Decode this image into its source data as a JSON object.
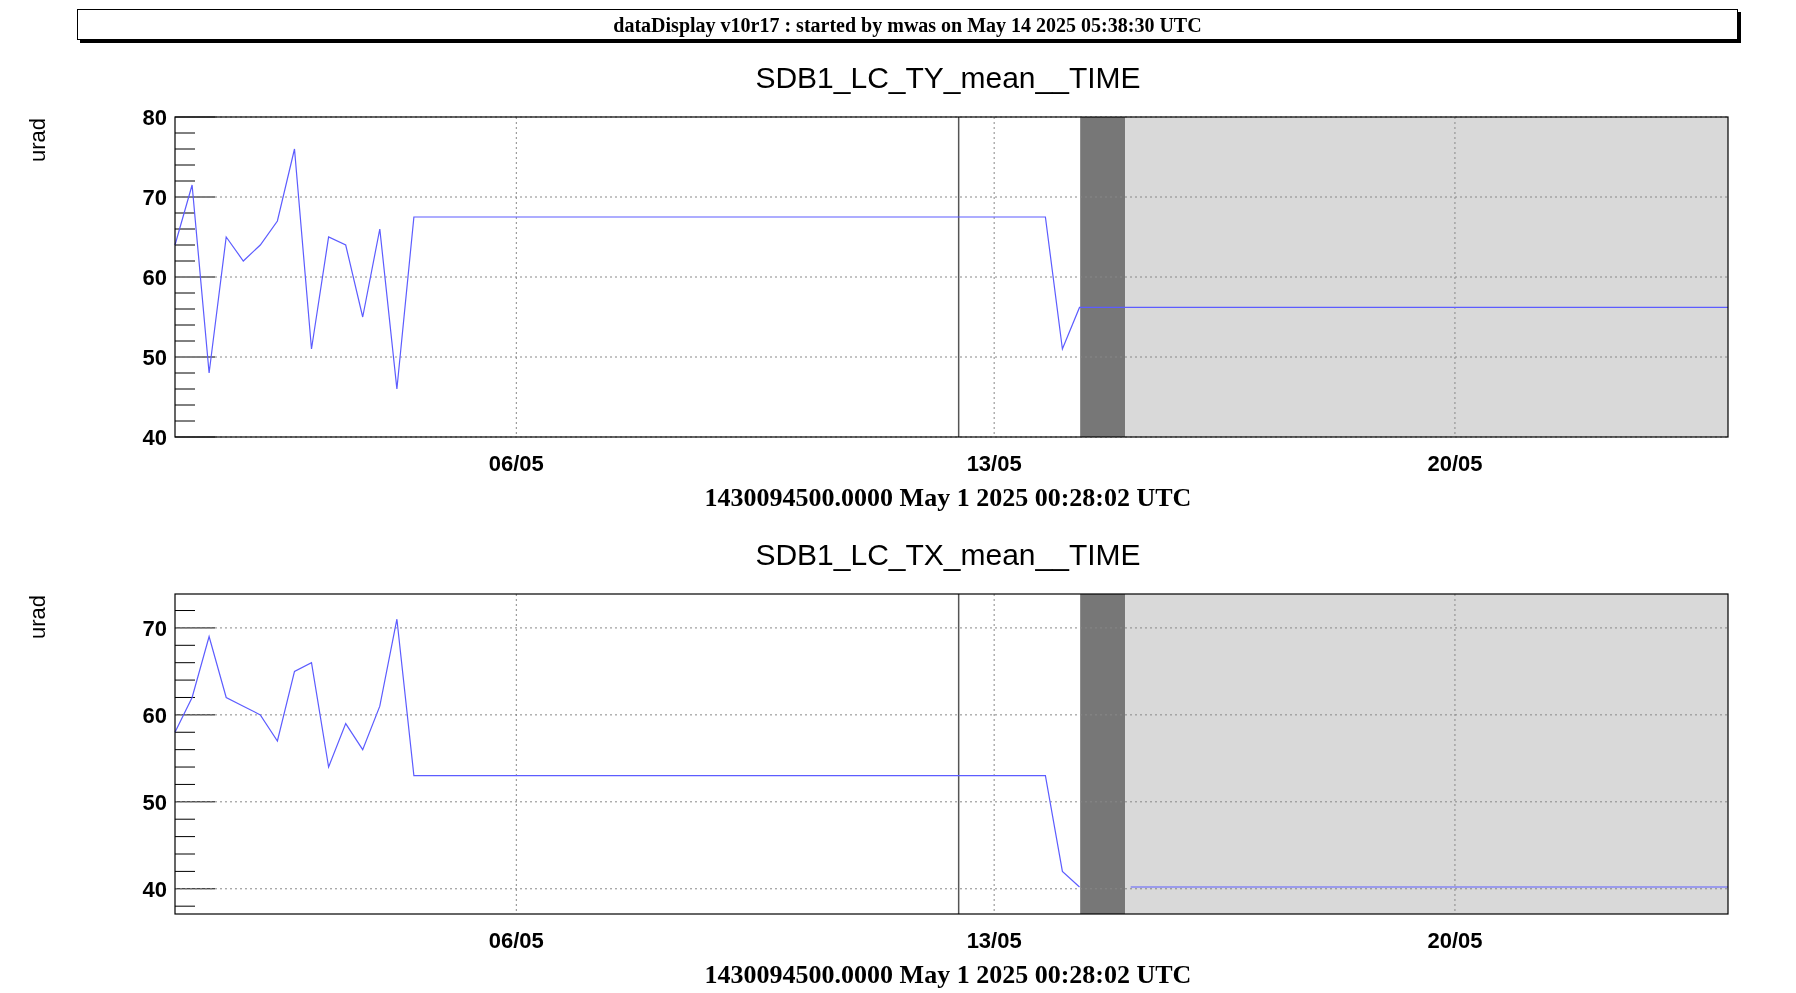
{
  "header": {
    "title": "dataDisplay v10r17 : started by mwas on May 14 2025 05:38:30 UTC"
  },
  "panels": [
    {
      "chart_data": {
        "type": "line",
        "title": "SDB1_LC_TY_mean__TIME",
        "xlabel": "1430094500.0000 May 1 2025 00:28:02 UTC",
        "ylabel": "urad",
        "categories": [
          null,
          null,
          null,
          null,
          null,
          null,
          null,
          null,
          null,
          null,
          null,
          null,
          null,
          null,
          null,
          null,
          null,
          null,
          null,
          null,
          "06/05",
          null,
          null,
          null,
          null,
          null,
          null,
          null,
          null,
          null,
          null,
          null,
          null,
          null,
          null,
          null,
          null,
          null,
          null,
          null,
          null,
          null,
          null,
          null,
          null,
          null,
          null,
          null,
          "13/05",
          null,
          null,
          null,
          null,
          null,
          null,
          null,
          null,
          null,
          null,
          null,
          null,
          null,
          null,
          null,
          null,
          null,
          null,
          null,
          null,
          null,
          null,
          null,
          null,
          null,
          null,
          "20/05",
          null,
          null,
          null,
          null,
          null,
          null,
          null,
          null,
          null,
          null,
          null,
          null,
          null,
          null,
          null,
          null
        ],
        "series": [
          {
            "color": "#5c5cff",
            "values": [
              64,
              71.5,
              48,
              65,
              62,
              64,
              67,
              76,
              51,
              65,
              64,
              55,
              66,
              46,
              67.5,
              67.5,
              67.5,
              67.5,
              67.5,
              67.5,
              67.5,
              67.5,
              67.5,
              67.5,
              67.5,
              67.5,
              67.5,
              67.5,
              67.5,
              67.5,
              67.5,
              67.5,
              67.5,
              67.5,
              67.5,
              67.5,
              67.5,
              67.5,
              67.5,
              67.5,
              67.5,
              67.5,
              67.5,
              67.5,
              67.5,
              67.5,
              67.5,
              67.5,
              67.5,
              67.5,
              67.5,
              67.5,
              51,
              56.2,
              56.2,
              56.2,
              56.2,
              56.2,
              56.2,
              56.2,
              56.2,
              56.2,
              56.2,
              56.2,
              56.2,
              56.2,
              56.2,
              56.2,
              56.2,
              56.2,
              56.2,
              56.2,
              56.2,
              56.2,
              56.2,
              56.2,
              56.2,
              56.2,
              56.2,
              56.2,
              56.2,
              56.2,
              56.2,
              56.2,
              56.2,
              56.2,
              56.2,
              56.2,
              56.2,
              56.2,
              56.2,
              56.2
            ]
          }
        ],
        "ylim": [
          40,
          80
        ],
        "yticks": [
          40,
          50,
          60,
          70,
          80
        ],
        "grid": true
      }
    },
    {
      "chart_data": {
        "type": "line",
        "title": "SDB1_LC_TX_mean__TIME",
        "xlabel": "1430094500.0000 May 1 2025 00:28:02 UTC",
        "ylabel": "urad",
        "categories": [
          null,
          null,
          null,
          null,
          null,
          null,
          null,
          null,
          null,
          null,
          null,
          null,
          null,
          null,
          null,
          null,
          null,
          null,
          null,
          null,
          "06/05",
          null,
          null,
          null,
          null,
          null,
          null,
          null,
          null,
          null,
          null,
          null,
          null,
          null,
          null,
          null,
          null,
          null,
          null,
          null,
          null,
          null,
          null,
          null,
          null,
          null,
          null,
          null,
          "13/05",
          null,
          null,
          null,
          null,
          null,
          null,
          null,
          null,
          null,
          null,
          null,
          null,
          null,
          null,
          null,
          null,
          null,
          null,
          null,
          null,
          null,
          null,
          null,
          null,
          null,
          null,
          "20/05",
          null,
          null,
          null,
          null,
          null,
          null,
          null,
          null,
          null,
          null,
          null,
          null,
          null,
          null,
          null,
          null
        ],
        "series": [
          {
            "color": "#5c5cff",
            "values": [
              58,
              62,
              69,
              62,
              61,
              60,
              57,
              65,
              66,
              54,
              59,
              56,
              61,
              71,
              53,
              53,
              53,
              53,
              53,
              53,
              53,
              53,
              53,
              53,
              53,
              53,
              53,
              53,
              53,
              53,
              53,
              53,
              53,
              53,
              53,
              53,
              53,
              53,
              53,
              53,
              53,
              53,
              53,
              53,
              53,
              53,
              53,
              53,
              53,
              53,
              53,
              53,
              42,
              40.2,
              null,
              null,
              40.2,
              40.2,
              40.2,
              40.2,
              40.2,
              40.2,
              40.2,
              40.2,
              40.2,
              40.2,
              40.2,
              40.2,
              40.2,
              40.2,
              40.2,
              40.2,
              40.2,
              40.2,
              40.2,
              40.2,
              40.2,
              40.2,
              40.2,
              40.2,
              40.2,
              40.2,
              40.2,
              40.2,
              40.2,
              40.2,
              40.2,
              40.2,
              40.2,
              40.2,
              40.2,
              40.2
            ]
          }
        ],
        "ylim": [
          37.1,
          73.9
        ],
        "yticks": [
          40,
          50,
          60,
          70
        ],
        "grid": true
      }
    }
  ]
}
